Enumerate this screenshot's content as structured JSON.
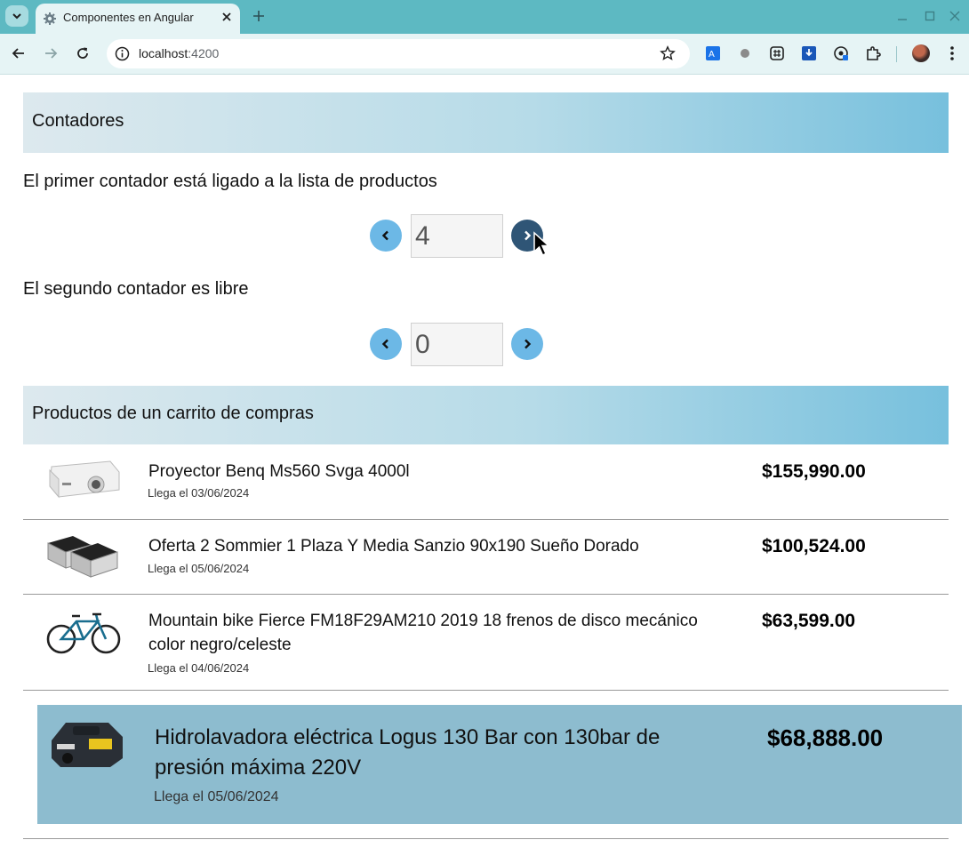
{
  "browser": {
    "tab_title": "Componentes en Angular",
    "url_host": "localhost",
    "url_port": ":4200"
  },
  "counters_section": {
    "title": "Contadores",
    "first_label": "El primer contador está ligado a la lista de productos",
    "first_value": "4",
    "second_label": "El segundo contador es libre",
    "second_value": "0"
  },
  "products_section": {
    "title": "Productos de un carrito de compras",
    "items": [
      {
        "name": "Proyector Benq Ms560 Svga 4000l",
        "date": "Llega el 03/06/2024",
        "price": "$155,990.00"
      },
      {
        "name": "Oferta 2 Sommier 1 Plaza Y Media Sanzio 90x190 Sueño Dorado",
        "date": "Llega el 05/06/2024",
        "price": "$100,524.00"
      },
      {
        "name": "Mountain bike Fierce FM18F29AM210 2019 18 frenos de disco mecánico color negro/celeste",
        "date": "Llega el 04/06/2024",
        "price": "$63,599.00"
      },
      {
        "name": "Hidrolavadora eléctrica Logus 130 Bar con 130bar de presión máxima 220V",
        "date": "Llega el 05/06/2024",
        "price": "$68,888.00"
      }
    ]
  },
  "icons": {
    "tab_favicon": "angular-gear-icon",
    "prev": "chevron-left-icon",
    "next": "chevron-right-icon"
  },
  "colors": {
    "tabbar": "#5db9c2",
    "counter_button": "#6cb8e6",
    "counter_button_active": "#2f5576",
    "highlight_row": "#8dbccf"
  }
}
